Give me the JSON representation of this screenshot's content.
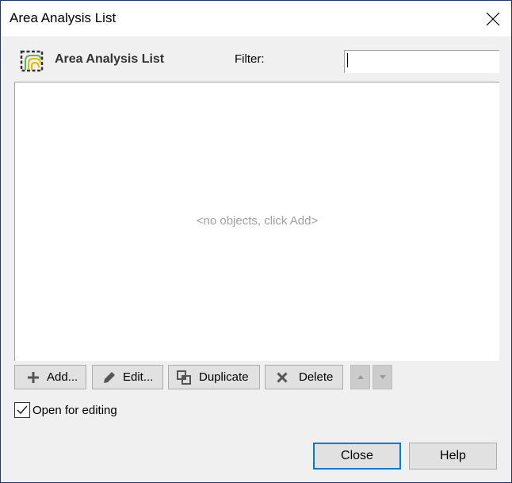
{
  "window": {
    "title": "Area Analysis List",
    "close_icon": "close-x-icon"
  },
  "header": {
    "icon": "area-analysis-icon",
    "title": "Area Analysis List",
    "filter_label": "Filter:",
    "filter_value": "",
    "filter_placeholder": ""
  },
  "list": {
    "items": [],
    "empty_message": "<no objects, click Add>"
  },
  "toolbar": {
    "add_label": "Add...",
    "add_icon": "plus-icon",
    "edit_label": "Edit...",
    "edit_icon": "pencil-icon",
    "duplicate_label": "Duplicate",
    "duplicate_icon": "duplicate-icon",
    "delete_label": "Delete",
    "delete_icon": "x-icon",
    "move_up_icon": "triangle-up-icon",
    "move_down_icon": "triangle-down-icon"
  },
  "options": {
    "open_for_editing_label": "Open for editing",
    "open_for_editing_checked": true
  },
  "footer": {
    "close_label": "Close",
    "help_label": "Help"
  },
  "colors": {
    "focus_border": "#0078d7",
    "window_border": "#1a3a6e",
    "icon_green": "#5fb35f",
    "icon_yellow": "#e6b800",
    "empty_text": "#a0a0a0"
  }
}
